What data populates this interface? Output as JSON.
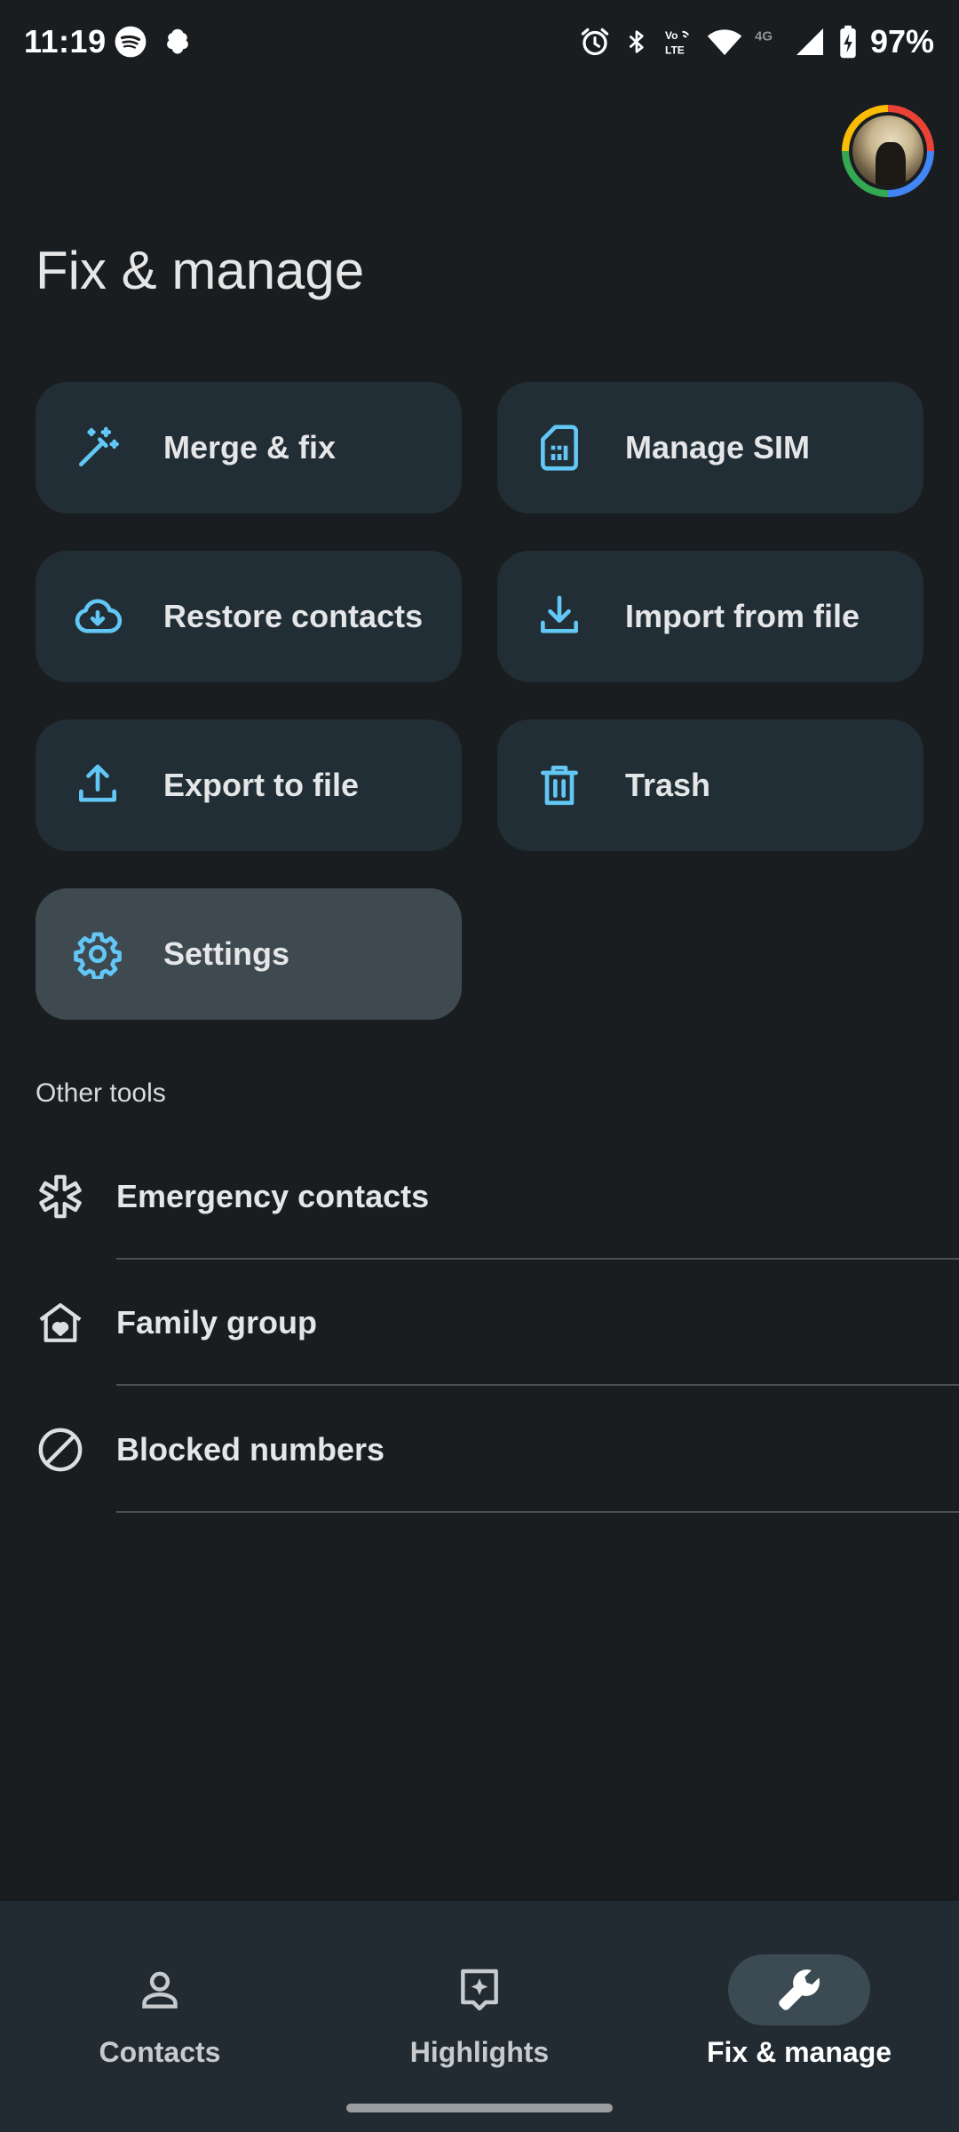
{
  "status_bar": {
    "time": "11:19",
    "network_type": "4G",
    "volte": "Vo LTE",
    "battery": "97%"
  },
  "header": {
    "title": "Fix & manage"
  },
  "cards": [
    {
      "label": "Merge & fix",
      "icon": "magic-wand-icon"
    },
    {
      "label": "Manage SIM",
      "icon": "sim-card-icon"
    },
    {
      "label": "Restore contacts",
      "icon": "cloud-download-icon"
    },
    {
      "label": "Import from file",
      "icon": "download-icon"
    },
    {
      "label": "Export to file",
      "icon": "upload-icon"
    },
    {
      "label": "Trash",
      "icon": "trash-icon"
    },
    {
      "label": "Settings",
      "icon": "gear-icon"
    }
  ],
  "other_tools": {
    "title": "Other tools",
    "items": [
      {
        "label": "Emergency contacts",
        "icon": "medical-asterisk-icon"
      },
      {
        "label": "Family group",
        "icon": "family-home-icon"
      },
      {
        "label": "Blocked numbers",
        "icon": "block-icon"
      }
    ]
  },
  "bottom_nav": {
    "items": [
      {
        "label": "Contacts",
        "icon": "person-icon"
      },
      {
        "label": "Highlights",
        "icon": "sparkle-box-icon"
      },
      {
        "label": "Fix & manage",
        "icon": "wrench-icon"
      }
    ],
    "active_index": 2
  },
  "colors": {
    "background": "#1a1d20",
    "card": "#222e35",
    "card_selected": "#3e4a50",
    "accent_icon": "#62c7f5",
    "nav_background": "#222b31"
  }
}
